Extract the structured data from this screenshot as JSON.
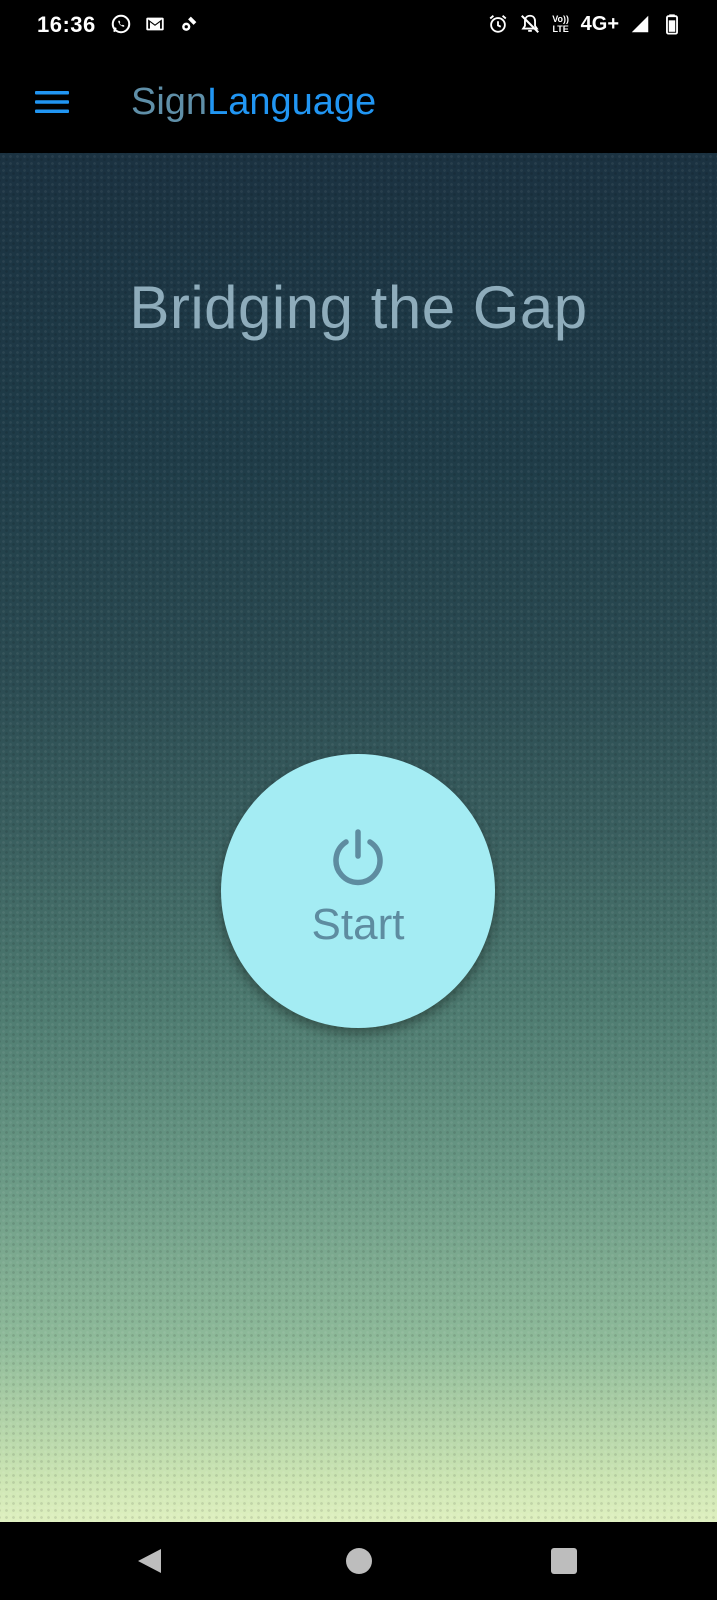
{
  "status_bar": {
    "time": "16:36",
    "left_icons": [
      "whatsapp-icon",
      "gmail-icon",
      "cast-icon"
    ],
    "right_icons": [
      "alarm-icon",
      "bell-off-icon",
      "volte-icon",
      "network-type",
      "signal-icon",
      "battery-icon"
    ],
    "volte_label_top": "Vo))",
    "volte_label_bottom": "LTE",
    "network_type": "4G+"
  },
  "app_bar": {
    "title_part1": "Sign",
    "title_part2": "Language",
    "menu_icon": "hamburger-menu-icon"
  },
  "main": {
    "hero_title": "Bridging the Gap",
    "start_button": {
      "icon": "power-icon",
      "label": "Start"
    }
  },
  "nav_bar": {
    "buttons": [
      "back-icon",
      "home-icon",
      "recents-icon"
    ]
  },
  "colors": {
    "accent": "#2196f3",
    "title_muted": "#5f8fa8",
    "hero_text": "#8eacbb",
    "start_button_bg": "#a4ecf3",
    "start_button_fg": "#5e8ca0"
  }
}
